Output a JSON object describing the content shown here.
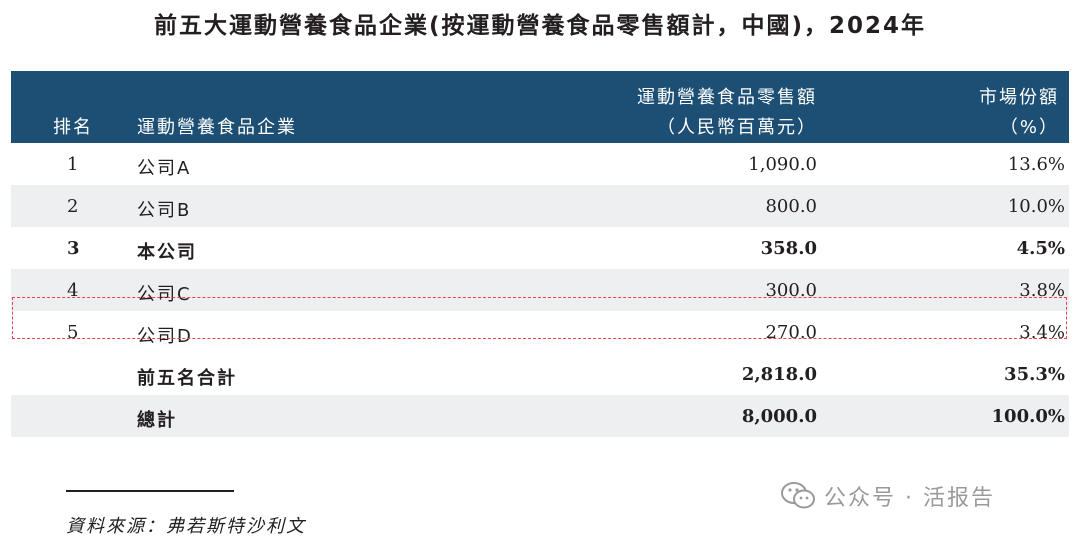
{
  "title": "前五大運動營養食品企業(按運動營養食品零售額計，中國)，2024年",
  "header": {
    "rank": "排名",
    "company": "運動營養食品企業",
    "sales_line1": "運動營養食品零售額",
    "sales_line2": "（人民幣百萬元）",
    "share_line1": "市場份額",
    "share_line2": "（%）"
  },
  "rows": [
    {
      "rank": "1",
      "company": "公司A",
      "sales": "1,090.0",
      "share": "13.6%"
    },
    {
      "rank": "2",
      "company": "公司B",
      "sales": "800.0",
      "share": "10.0%"
    },
    {
      "rank": "3",
      "company": "本公司",
      "sales": "358.0",
      "share": "4.5%"
    },
    {
      "rank": "4",
      "company": "公司C",
      "sales": "300.0",
      "share": "3.8%"
    },
    {
      "rank": "5",
      "company": "公司D",
      "sales": "270.0",
      "share": "3.4%"
    },
    {
      "rank": "",
      "company": "前五名合計",
      "sales": "2,818.0",
      "share": "35.3%"
    },
    {
      "rank": "",
      "company": "總計",
      "sales": "8,000.0",
      "share": "100.0%"
    }
  ],
  "source": "資料來源：弗若斯特沙利文",
  "watermark": "公众号 · 活报告",
  "colors": {
    "header_bg": "#1d4f74",
    "row_shade": "#eeeff0",
    "highlight_border": "#e8424a"
  }
}
